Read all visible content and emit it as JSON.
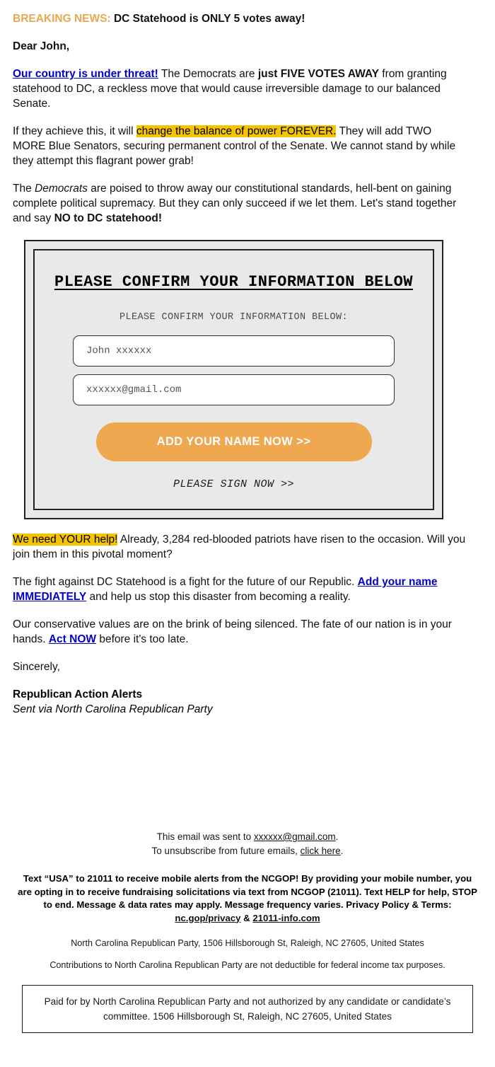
{
  "email": {
    "headline": {
      "label": "BREAKING NEWS:",
      "text": "DC Statehood is ONLY 5 votes away!"
    },
    "salutation": "Dear John,",
    "paragraph1": {
      "link": "Our country is under threat!",
      "part1": " The Democrats are ",
      "bold1": "just FIVE VOTES AWAY",
      "part2": " from granting statehood to DC, a reckless move that would cause irreversible damage to our balanced Senate."
    },
    "paragraph2": {
      "part1": "If they achieve this, it will ",
      "highlight": "change the balance of power FOREVER.",
      "part2": " They will add TWO MORE Blue Senators, securing permanent control of the Senate. We cannot stand by while they attempt this flagrant power grab!"
    },
    "paragraph3": {
      "part1": "The ",
      "italic": "Democrats",
      "part2": " are poised to throw away our constitutional standards, hell-bent on gaining complete political supremacy. But they can only succeed if we let them. Let's stand together and say ",
      "bold": "NO to DC statehood!"
    },
    "paragraph4": {
      "highlight": "We need YOUR help!",
      "text": " Already, 3,284 red-blooded patriots have risen to the occasion. Will you join them in this pivotal moment?"
    },
    "paragraph5": {
      "part1": "The fight against DC Statehood is a fight for the future of our Republic. ",
      "link": "Add your name IMMEDIATELY",
      "part2": " and help us stop this disaster from becoming a reality."
    },
    "paragraph6": {
      "part1": "Our conservative values are on the brink of being silenced. The fate of our nation is in your hands. ",
      "link": "Act NOW",
      "part2": " before it's too late."
    },
    "closing": "Sincerely,",
    "signature_name": "Republican Action Alerts",
    "signature_org": "Sent via North Carolina Republican Party"
  },
  "form": {
    "title": "PLEASE CONFIRM YOUR INFORMATION BELOW",
    "subtitle": "PLEASE CONFIRM YOUR INFORMATION BELOW:",
    "name_value": "John xxxxxx",
    "name_placeholder": "John xxxxxx",
    "email_value": "xxxxxx@gmail.com",
    "email_placeholder": "xxxxxx@gmail.com",
    "submit_label": "ADD YOUR NAME NOW >>",
    "sign_now_label": "PLEASE SIGN NOW >>",
    "button_color": "#efa84f",
    "background_color": "#e9e9e9"
  },
  "footer": {
    "sent_to_prefix": "This email was sent to ",
    "sent_to_email": "xxxxxx@gmail.com",
    "sent_to_suffix": ".",
    "unsubscribe_prefix": "To unsubscribe from future emails, ",
    "unsubscribe_link": "click here",
    "unsubscribe_suffix": ".",
    "sms_text": "Text “USA” to 21011 to receive mobile alerts from the NCGOP! By providing your mobile number, you are opting in to receive fundraising solicitations via text from NCGOP (21011). Text HELP for help, STOP to end. Message & data rates may apply. Message frequency varies. Privacy Policy & Terms: ",
    "sms_link1": "nc.gop/privacy",
    "sms_amp": " & ",
    "sms_link2": "21011-info.com",
    "address": "North Carolina Republican Party, 1506 Hillsborough St, Raleigh, NC 27605, United States",
    "contributions": "Contributions to North Carolina Republican Party are not deductible for federal income tax purposes.",
    "disclaimer": "Paid for by North Carolina Republican Party and not authorized by any candidate or candidate’s committee. 1506 Hillsborough St, Raleigh, NC 27605, United States"
  },
  "colors": {
    "accent_orange": "#e8a852",
    "highlight_yellow": "#f5c400",
    "link_blue": "#0000cc"
  }
}
